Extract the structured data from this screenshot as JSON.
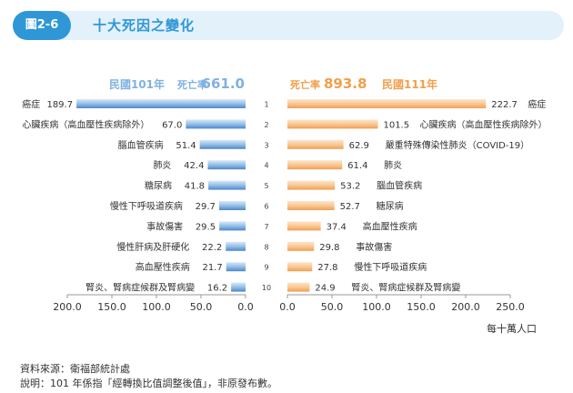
{
  "header": {
    "figure_label": "圖2-6",
    "title": "十大死因之變化"
  },
  "chart_data": {
    "type": "bar",
    "left_panel": {
      "year_label": "民國101年",
      "rate_label": "死亡率",
      "rate_value": "661.0",
      "series_color": "#7fb2e0",
      "causes": [
        "癌症",
        "心臟疾病（高血壓性疾病除外）",
        "腦血管疾病",
        "肺炎",
        "糖尿病",
        "慢性下呼吸道疾病",
        "事故傷害",
        "慢性肝病及肝硬化",
        "高血壓性疾病",
        "腎炎、腎病症候群及腎病變"
      ],
      "values": [
        189.7,
        67.0,
        51.4,
        42.4,
        41.8,
        29.7,
        29.5,
        22.2,
        21.7,
        16.2
      ],
      "value_labels": [
        "189.7",
        "67.0",
        "51.4",
        "42.4",
        "41.8",
        "29.7",
        "29.5",
        "22.2",
        "21.7",
        "16.2"
      ],
      "xlim": [
        200,
        0
      ],
      "ticks": [
        "200.0",
        "150.0",
        "100.0",
        "50.0",
        "0.0"
      ]
    },
    "right_panel": {
      "rate_label": "死亡率",
      "rate_value": "893.8",
      "year_label": "民國111年",
      "series_color": "#f7be83",
      "causes": [
        "癌症",
        "心臟疾病（高血壓性疾病除外）",
        "嚴重特殊傳染性肺炎（COVID-19）",
        "肺炎",
        "腦血管疾病",
        "糖尿病",
        "高血壓性疾病",
        "事故傷害",
        "慢性下呼吸道疾病",
        "腎炎、腎病症候群及腎病變"
      ],
      "values": [
        222.7,
        101.5,
        62.9,
        61.4,
        53.2,
        52.7,
        37.4,
        29.8,
        27.8,
        24.9
      ],
      "value_labels": [
        "222.7",
        "101.5",
        "62.9",
        "61.4",
        "53.2",
        "52.7",
        "37.4",
        "29.8",
        "27.8",
        "24.9"
      ],
      "xlim": [
        0,
        250
      ],
      "ticks": [
        "0.0",
        "50.0",
        "100.0",
        "150.0",
        "200.0",
        "250.0"
      ]
    },
    "ranks": [
      "1",
      "2",
      "3",
      "4",
      "5",
      "6",
      "7",
      "8",
      "9",
      "10"
    ],
    "unit": "每十萬人口",
    "colors": {
      "left_text": "#7fb2e0",
      "right_text": "#f0a04b"
    }
  },
  "notes": {
    "source": "資料來源：衛福部統計處",
    "explanation": "說明：101 年係指「經轉換比值調整後值」，非原發布數。"
  }
}
